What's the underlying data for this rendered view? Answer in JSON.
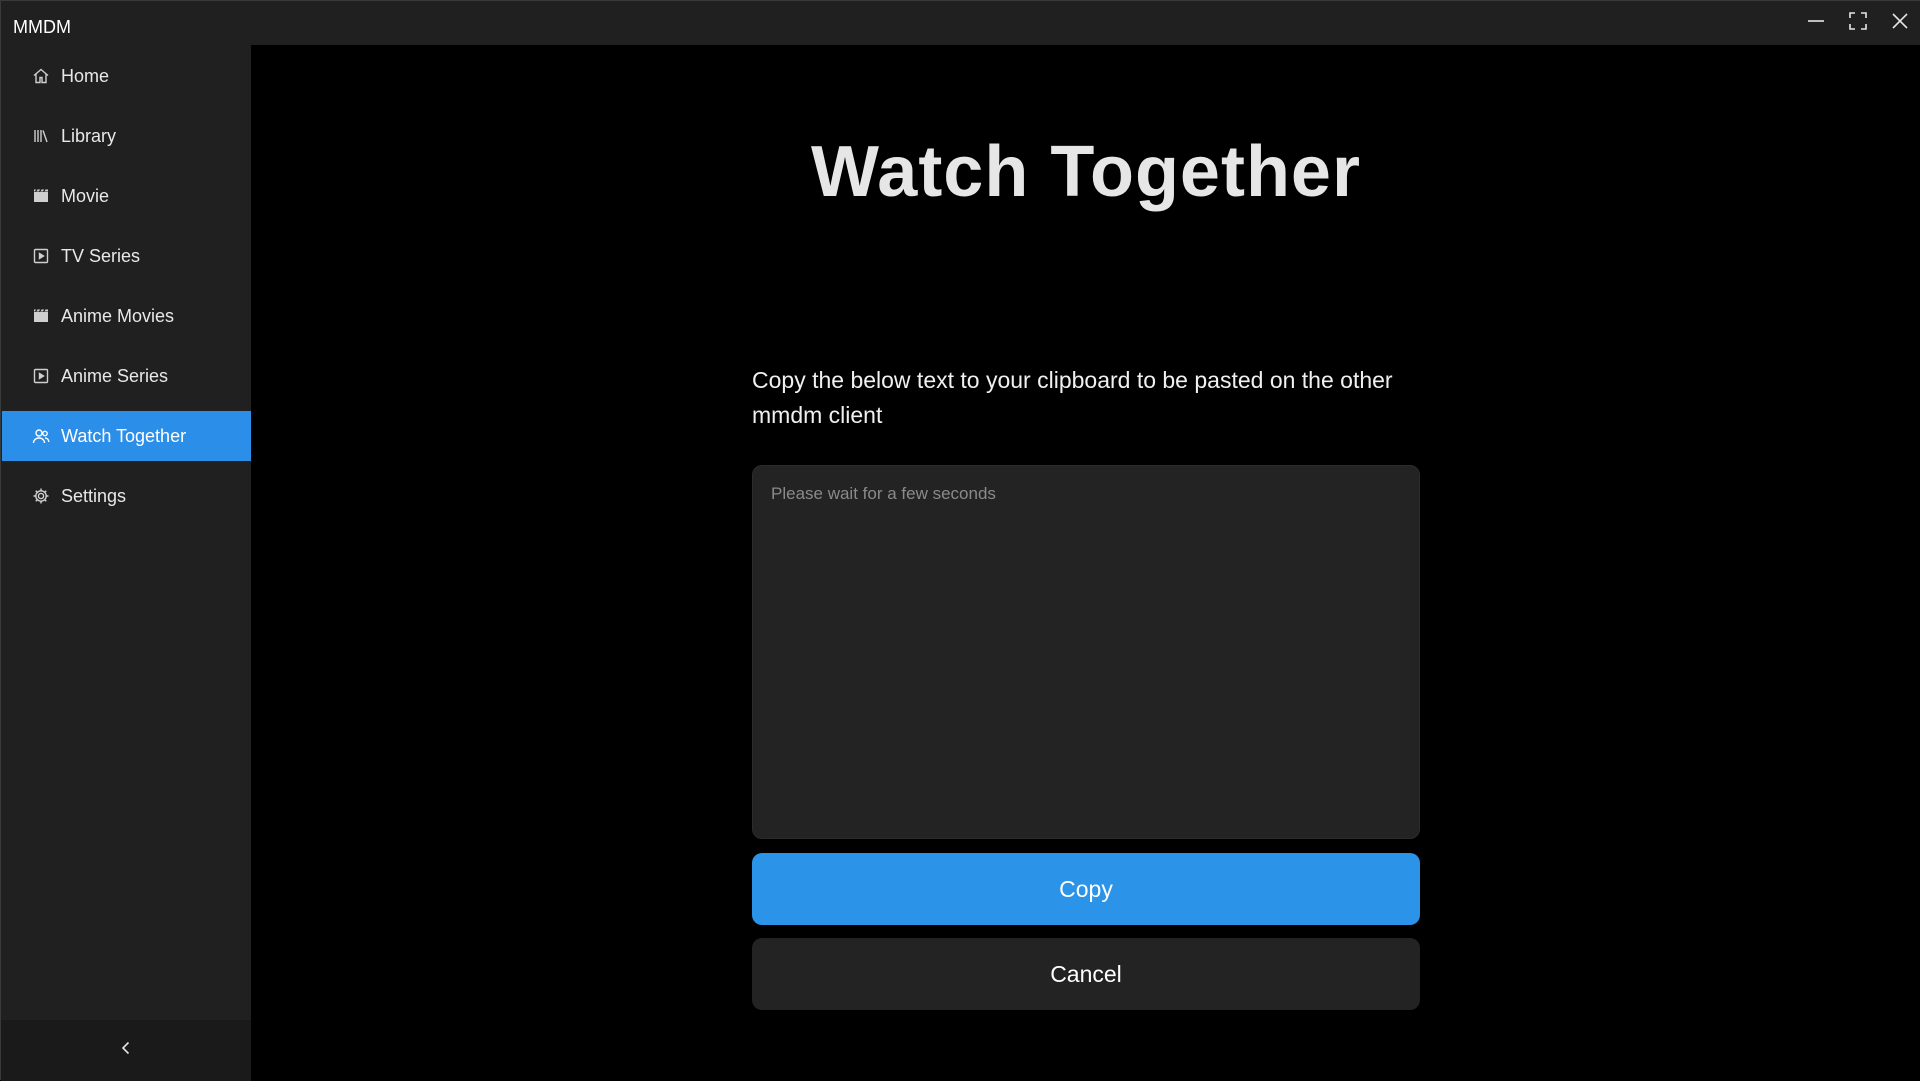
{
  "app": {
    "title": "MMDM"
  },
  "window_controls": {
    "minimize": "minimize-icon",
    "maximize": "maximize-icon",
    "close": "close-icon"
  },
  "sidebar": {
    "items": [
      {
        "label": "Home",
        "icon": "home-icon",
        "active": false
      },
      {
        "label": "Library",
        "icon": "library-icon",
        "active": false
      },
      {
        "label": "Movie",
        "icon": "clapperboard-icon",
        "active": false
      },
      {
        "label": "TV Series",
        "icon": "play-square-icon",
        "active": false
      },
      {
        "label": "Anime Movies",
        "icon": "clapperboard-icon",
        "active": false
      },
      {
        "label": "Anime Series",
        "icon": "play-square-icon",
        "active": false
      },
      {
        "label": "Watch Together",
        "icon": "people-icon",
        "active": true
      },
      {
        "label": "Settings",
        "icon": "gear-icon",
        "active": false
      }
    ],
    "collapse_icon": "chevron-left-icon"
  },
  "main": {
    "title": "Watch Together",
    "instructions": "Copy the below text to your clipboard to be pasted on the other mmdm client",
    "textarea": {
      "value": "",
      "placeholder": "Please wait for a few seconds"
    },
    "copy_label": "Copy",
    "cancel_label": "Cancel"
  },
  "colors": {
    "accent": "#2b8ee8",
    "sidebar_bg": "#202020",
    "main_bg": "#000000",
    "surface": "#232323"
  }
}
